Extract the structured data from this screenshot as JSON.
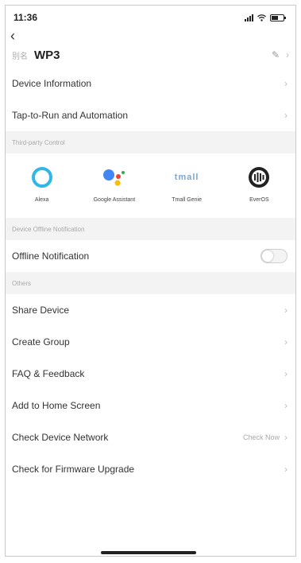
{
  "status_bar": {
    "time": "11:36"
  },
  "header": {
    "title_prefix": "别名",
    "device_name": "WP3"
  },
  "top_items": [
    {
      "label": "Device Information",
      "name": "device-information"
    },
    {
      "label": "Tap-to-Run and Automation",
      "name": "tap-to-run-and-automation"
    }
  ],
  "sections": {
    "third_party": "Third-party Control",
    "offline": "Device Offline Notification",
    "others": "Others"
  },
  "third_party": [
    {
      "label": "Alexa",
      "icon": "alexa-icon"
    },
    {
      "label": "Google Assistant",
      "icon": "google-assistant-icon"
    },
    {
      "label": "Tmall Genie",
      "icon": "tmall-genie-icon",
      "logo_text": "tmall"
    },
    {
      "label": "EverOS",
      "icon": "everos-icon"
    }
  ],
  "offline": {
    "label": "Offline Notification",
    "enabled": false
  },
  "others_items": [
    {
      "label": "Share Device",
      "name": "share-device"
    },
    {
      "label": "Create Group",
      "name": "create-group"
    },
    {
      "label": "FAQ & Feedback",
      "name": "faq-feedback"
    },
    {
      "label": "Add to Home Screen",
      "name": "add-to-home-screen"
    },
    {
      "label": "Check Device Network",
      "name": "check-device-network",
      "right_text": "Check Now"
    },
    {
      "label": "Check for Firmware Upgrade",
      "name": "check-firmware-upgrade"
    }
  ],
  "colors": {
    "alexa": "#2fb7e6",
    "google_blue": "#4285f4",
    "google_red": "#ea4335",
    "google_yellow": "#fbbc05",
    "google_green": "#34a853",
    "tmall": "#7aa7d6",
    "everos": "#222222"
  }
}
